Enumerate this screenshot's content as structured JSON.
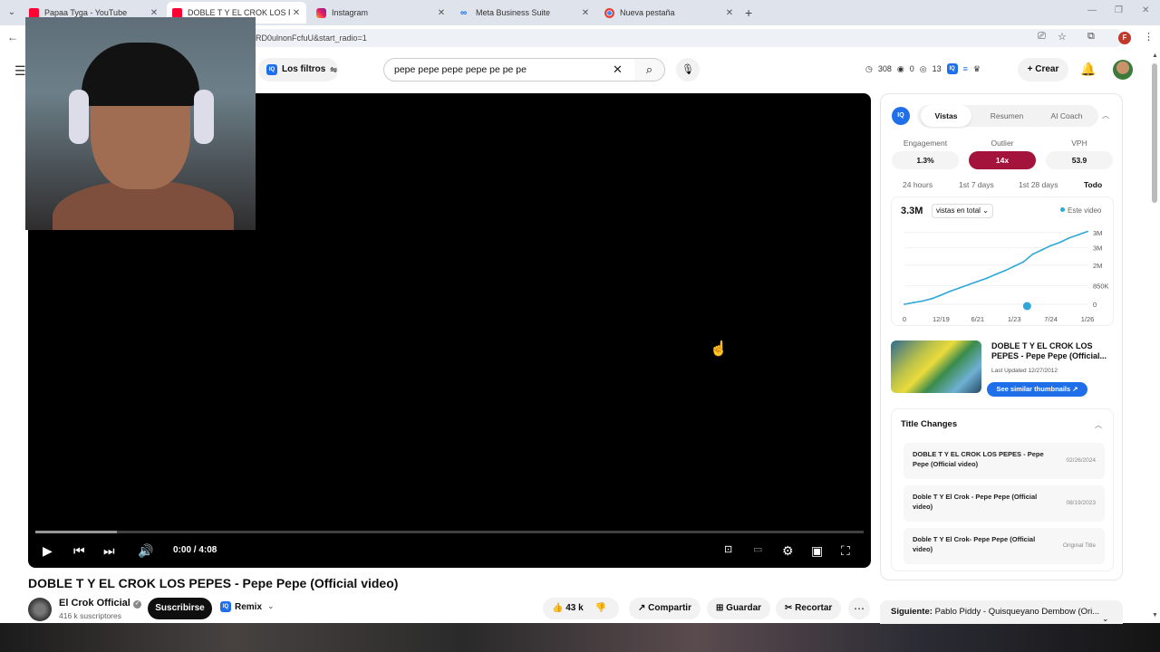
{
  "browser": {
    "tabs": [
      {
        "title": "Papaa Tyga - YouTube",
        "icon": "youtube-icon",
        "active": false
      },
      {
        "title": "DOBLE T Y EL CROK LOS PEPES",
        "icon": "youtube-icon",
        "active": true
      },
      {
        "title": "Instagram",
        "icon": "instagram-icon",
        "active": false
      },
      {
        "title": "Meta Business Suite",
        "icon": "meta-icon",
        "active": false
      },
      {
        "title": "Nueva pestaña",
        "icon": "chrome-icon",
        "active": false
      }
    ],
    "url": "RD0ulnonFcfuU&start_radio=1",
    "profile_initial": "F"
  },
  "header": {
    "filters_label": "Los filtros",
    "search_value": "pepe pepe pepe pepe pe pe pe",
    "stats": {
      "views": "308",
      "zero": "0",
      "count": "13"
    },
    "create_label": "Crear",
    "iq_label": "IQ"
  },
  "player": {
    "time": "0:00 / 4:08",
    "progress_fraction": 0,
    "buffer_fraction": 0.098
  },
  "video": {
    "title": "DOBLE T Y EL CROK LOS PEPES - Pepe Pepe (Official video)",
    "channel": "El Crok Official",
    "subscribers": "416 k suscriptores",
    "subscribe_label": "Suscribirse",
    "remix_label": "Remix",
    "likes": "43 k",
    "share_label": "Compartir",
    "save_label": "Guardar",
    "clip_label": "Recortar"
  },
  "panel": {
    "tabs": [
      "Vistas",
      "Resumen",
      "AI Coach"
    ],
    "metrics": [
      {
        "label": "Engagement",
        "value": "1.3%"
      },
      {
        "label": "Outlier",
        "value": "14x",
        "highlight": true
      },
      {
        "label": "VPH",
        "value": "53.9"
      }
    ],
    "periods": [
      "24 hours",
      "1st 7 days",
      "1st 28 days",
      "Todo"
    ],
    "active_period": "Todo",
    "thumb_title": "DOBLE T Y EL CROK LOS PEPES - Pepe Pepe (Official...",
    "thumb_updated": "Last Updated 12/27/2012",
    "similar_label": "See similar thumbnails ↗",
    "title_changes_label": "Title Changes",
    "title_changes": [
      {
        "title": "DOBLE T Y EL CROK LOS PEPES - Pepe Pepe (Official video)",
        "date": "02/26/2024"
      },
      {
        "title": "Doble T Y El Crok - Pepe Pepe (Official video)",
        "date": "08/19/2023"
      },
      {
        "title": "Doble T Y El Crok- Pepe Pepe (Official video)",
        "date": "Original Title"
      }
    ]
  },
  "chart_data": {
    "type": "line",
    "total_label": "3.3M",
    "select_label": "vistas en total",
    "series": [
      {
        "name": "Este video",
        "color": "#2fa7d8",
        "x": [
          0,
          0.05,
          0.1,
          0.15,
          0.2,
          0.25,
          0.3,
          0.35,
          0.4,
          0.45,
          0.5,
          0.55,
          0.6,
          0.65,
          0.7,
          0.75,
          0.8,
          0.85,
          0.9,
          0.95,
          1.0
        ],
        "values": [
          0,
          0.08,
          0.15,
          0.26,
          0.42,
          0.6,
          0.75,
          0.9,
          1.05,
          1.2,
          1.38,
          1.55,
          1.75,
          1.95,
          2.3,
          2.5,
          2.7,
          2.85,
          3.05,
          3.2,
          3.35
        ]
      }
    ],
    "x_tick_labels": [
      "0",
      "12/19",
      "6/21",
      "1/23",
      "7/24",
      "1/26"
    ],
    "y_tick_labels": [
      "3M",
      "3M",
      "2M",
      "850K",
      "0"
    ],
    "y_tick_values": [
      3.3,
      2.6,
      1.8,
      0.85,
      0
    ],
    "ylim": [
      0,
      3.5
    ],
    "marker_x": 0.67
  },
  "up_next": {
    "label": "Siguiente:",
    "title": "Pablo Piddy - Quisqueyano Dembow (Ori..."
  }
}
